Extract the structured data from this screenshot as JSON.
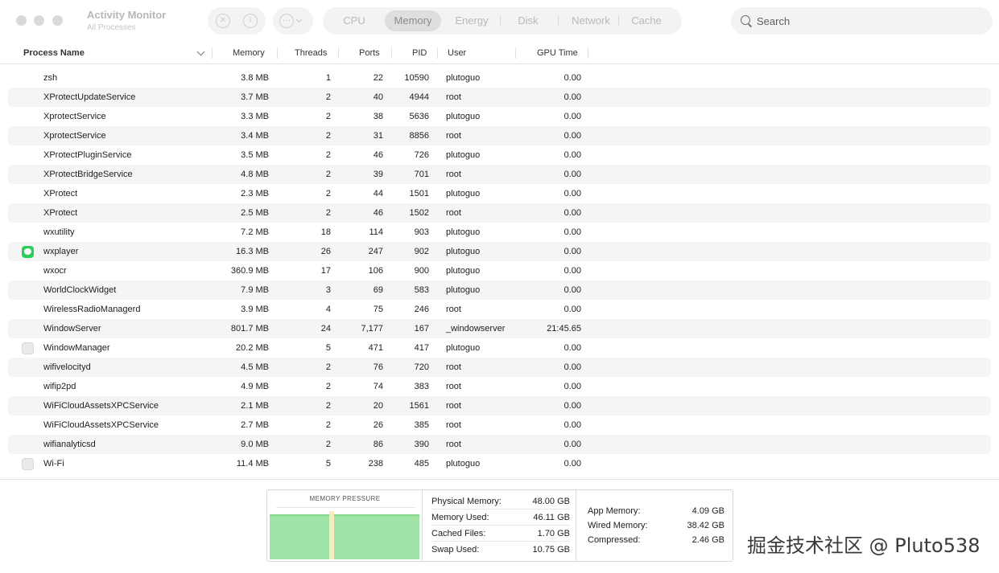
{
  "window": {
    "title": "Activity Monitor",
    "subtitle": "All Processes"
  },
  "toolbar": {
    "stop_icon": "stop-process-icon",
    "info_icon": "info-icon",
    "more_icon": "more-options-icon"
  },
  "tabs": [
    {
      "label": "CPU",
      "active": false
    },
    {
      "label": "Memory",
      "active": true
    },
    {
      "label": "Energy",
      "active": false
    },
    {
      "label": "Disk",
      "active": false
    },
    {
      "label": "Network",
      "active": false
    },
    {
      "label": "Cache",
      "active": false
    }
  ],
  "search": {
    "placeholder": "Search",
    "value": ""
  },
  "columns": {
    "name": "Process Name",
    "memory": "Memory",
    "threads": "Threads",
    "ports": "Ports",
    "pid": "PID",
    "user": "User",
    "gpu": "GPU Time"
  },
  "processes": [
    {
      "icon": "",
      "name": "zsh",
      "memory": "3.8 MB",
      "threads": "1",
      "ports": "22",
      "pid": "10590",
      "user": "plutoguo",
      "gpu": "0.00"
    },
    {
      "icon": "",
      "name": "XProtectUpdateService",
      "memory": "3.7 MB",
      "threads": "2",
      "ports": "40",
      "pid": "4944",
      "user": "root",
      "gpu": "0.00"
    },
    {
      "icon": "",
      "name": "XprotectService",
      "memory": "3.3 MB",
      "threads": "2",
      "ports": "38",
      "pid": "5636",
      "user": "plutoguo",
      "gpu": "0.00"
    },
    {
      "icon": "",
      "name": "XprotectService",
      "memory": "3.4 MB",
      "threads": "2",
      "ports": "31",
      "pid": "8856",
      "user": "root",
      "gpu": "0.00"
    },
    {
      "icon": "",
      "name": "XProtectPluginService",
      "memory": "3.5 MB",
      "threads": "2",
      "ports": "46",
      "pid": "726",
      "user": "plutoguo",
      "gpu": "0.00"
    },
    {
      "icon": "",
      "name": "XProtectBridgeService",
      "memory": "4.8 MB",
      "threads": "2",
      "ports": "39",
      "pid": "701",
      "user": "root",
      "gpu": "0.00"
    },
    {
      "icon": "",
      "name": "XProtect",
      "memory": "2.3 MB",
      "threads": "2",
      "ports": "44",
      "pid": "1501",
      "user": "plutoguo",
      "gpu": "0.00"
    },
    {
      "icon": "",
      "name": "XProtect",
      "memory": "2.5 MB",
      "threads": "2",
      "ports": "46",
      "pid": "1502",
      "user": "root",
      "gpu": "0.00"
    },
    {
      "icon": "",
      "name": "wxutility",
      "memory": "7.2 MB",
      "threads": "18",
      "ports": "114",
      "pid": "903",
      "user": "plutoguo",
      "gpu": "0.00"
    },
    {
      "icon": "wechat-icon",
      "name": "wxplayer",
      "memory": "16.3 MB",
      "threads": "26",
      "ports": "247",
      "pid": "902",
      "user": "plutoguo",
      "gpu": "0.00"
    },
    {
      "icon": "",
      "name": "wxocr",
      "memory": "360.9 MB",
      "threads": "17",
      "ports": "106",
      "pid": "900",
      "user": "plutoguo",
      "gpu": "0.00"
    },
    {
      "icon": "",
      "name": "WorldClockWidget",
      "memory": "7.9 MB",
      "threads": "3",
      "ports": "69",
      "pid": "583",
      "user": "plutoguo",
      "gpu": "0.00"
    },
    {
      "icon": "",
      "name": "WirelessRadioManagerd",
      "memory": "3.9 MB",
      "threads": "4",
      "ports": "75",
      "pid": "246",
      "user": "root",
      "gpu": "0.00"
    },
    {
      "icon": "",
      "name": "WindowServer",
      "memory": "801.7 MB",
      "threads": "24",
      "ports": "7,177",
      "pid": "167",
      "user": "_windowserver",
      "gpu": "21:45.65"
    },
    {
      "icon": "generic-app-icon",
      "name": "WindowManager",
      "memory": "20.2 MB",
      "threads": "5",
      "ports": "471",
      "pid": "417",
      "user": "plutoguo",
      "gpu": "0.00"
    },
    {
      "icon": "",
      "name": "wifivelocityd",
      "memory": "4.5 MB",
      "threads": "2",
      "ports": "76",
      "pid": "720",
      "user": "root",
      "gpu": "0.00"
    },
    {
      "icon": "",
      "name": "wifip2pd",
      "memory": "4.9 MB",
      "threads": "2",
      "ports": "74",
      "pid": "383",
      "user": "root",
      "gpu": "0.00"
    },
    {
      "icon": "",
      "name": "WiFiCloudAssetsXPCService",
      "memory": "2.1 MB",
      "threads": "2",
      "ports": "20",
      "pid": "1561",
      "user": "root",
      "gpu": "0.00"
    },
    {
      "icon": "",
      "name": "WiFiCloudAssetsXPCService",
      "memory": "2.7 MB",
      "threads": "2",
      "ports": "26",
      "pid": "385",
      "user": "root",
      "gpu": "0.00"
    },
    {
      "icon": "",
      "name": "wifianalyticsd",
      "memory": "9.0 MB",
      "threads": "2",
      "ports": "86",
      "pid": "390",
      "user": "root",
      "gpu": "0.00"
    },
    {
      "icon": "generic-app-icon",
      "name": "Wi-Fi",
      "memory": "11.4 MB",
      "threads": "5",
      "ports": "238",
      "pid": "485",
      "user": "plutoguo",
      "gpu": "0.00"
    }
  ],
  "memory_pressure": {
    "title": "MEMORY PRESSURE",
    "fill_color": "#9fe3a6",
    "fill_dark": "#83d68b",
    "spike_color": "#f6ecbf"
  },
  "memory_stats": [
    {
      "label": "Physical Memory:",
      "value": "48.00 GB"
    },
    {
      "label": "Memory Used:",
      "value": "46.11 GB"
    },
    {
      "label": "Cached Files:",
      "value": "1.70 GB"
    },
    {
      "label": "Swap Used:",
      "value": "10.75 GB"
    }
  ],
  "memory_breakdown": [
    {
      "label": "App Memory:",
      "value": "4.09 GB"
    },
    {
      "label": "Wired Memory:",
      "value": "38.42 GB"
    },
    {
      "label": "Compressed:",
      "value": "2.46 GB"
    }
  ],
  "watermark": "掘金技术社区 @ Pluto538"
}
